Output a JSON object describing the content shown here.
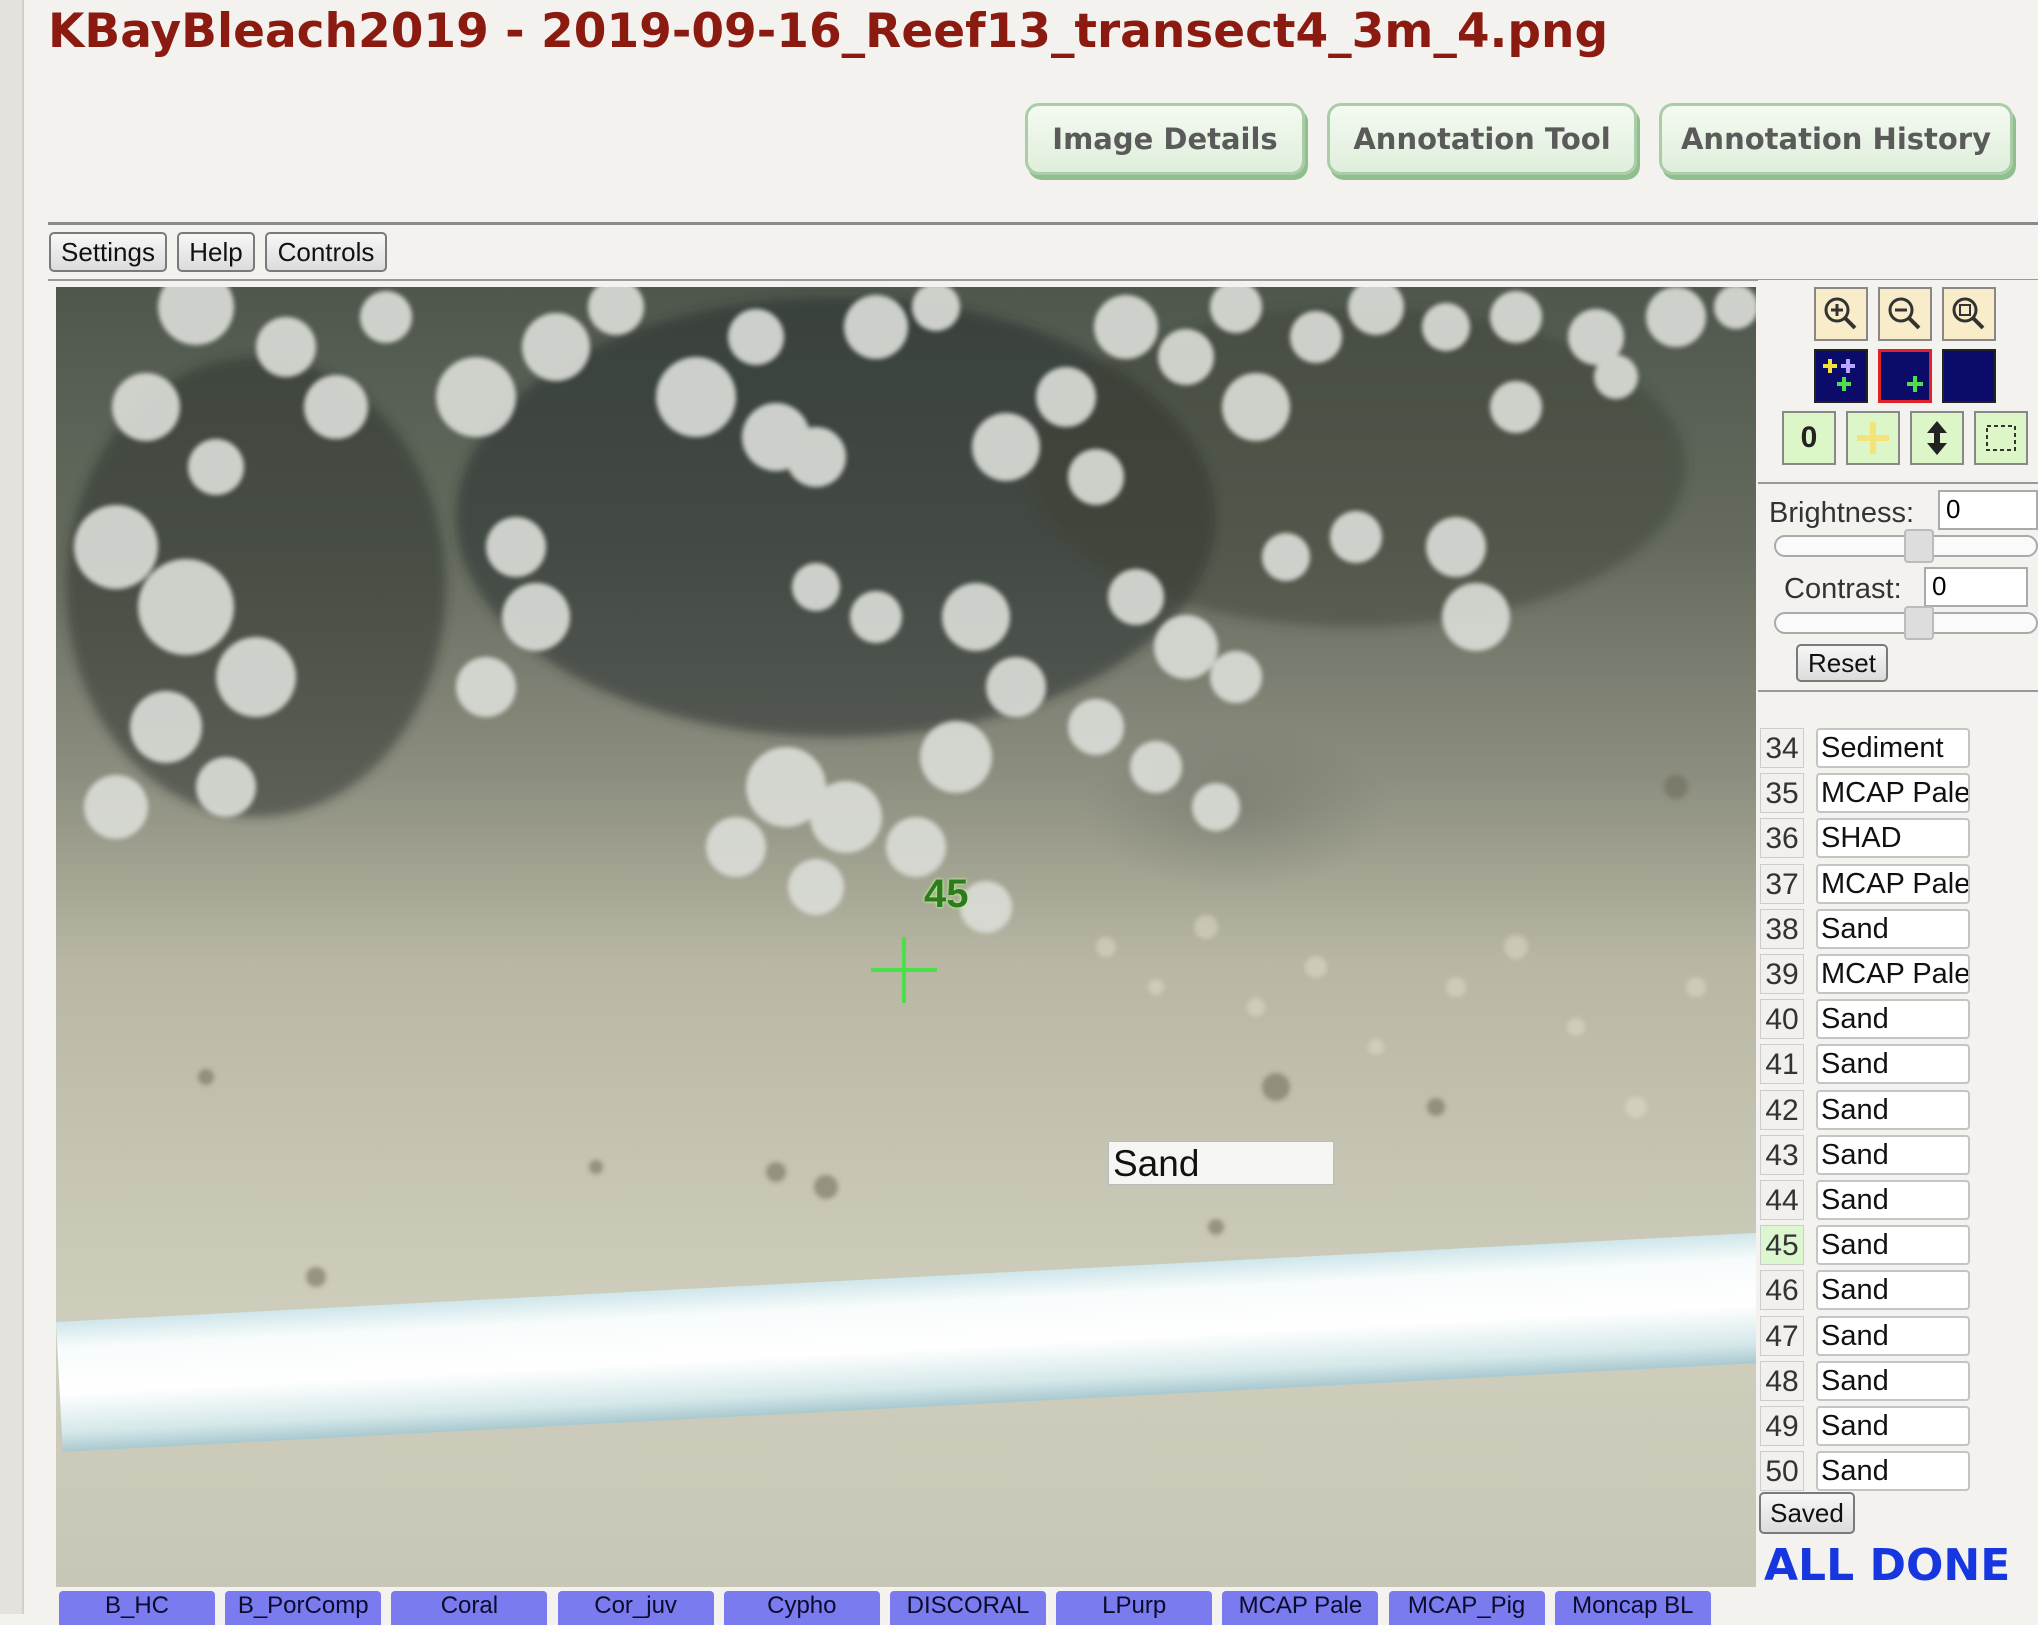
{
  "page": {
    "title": "KBayBleach2019 - 2019-09-16_Reef13_transect4_3m_4.png"
  },
  "nav": {
    "image_details": "Image Details",
    "annotation_tool": "Annotation Tool",
    "annotation_history": "Annotation History"
  },
  "toolbar": {
    "settings": "Settings",
    "help": "Help",
    "controls": "Controls"
  },
  "canvas": {
    "point_number": "45",
    "point_label_value": "Sand",
    "crosshair_color": "#4be04b"
  },
  "controls_panel": {
    "icons": [
      "zoom-in-icon",
      "zoom-out-icon",
      "zoom-fit-icon",
      "select-all-points-icon",
      "select-point-icon",
      "unselect-icon",
      "point-number-toggle-icon",
      "crosshair-toggle-icon",
      "move-icon",
      "rectangle-select-icon"
    ],
    "zero_button": "0",
    "brightness_label": "Brightness:",
    "brightness_value": "0",
    "contrast_label": "Contrast:",
    "contrast_value": "0",
    "reset": "Reset"
  },
  "points": [
    {
      "num": "34",
      "label": "Sediment"
    },
    {
      "num": "35",
      "label": "MCAP Pale"
    },
    {
      "num": "36",
      "label": "SHAD"
    },
    {
      "num": "37",
      "label": "MCAP Pale"
    },
    {
      "num": "38",
      "label": "Sand"
    },
    {
      "num": "39",
      "label": "MCAP Pale"
    },
    {
      "num": "40",
      "label": "Sand"
    },
    {
      "num": "41",
      "label": "Sand"
    },
    {
      "num": "42",
      "label": "Sand"
    },
    {
      "num": "43",
      "label": "Sand"
    },
    {
      "num": "44",
      "label": "Sand"
    },
    {
      "num": "45",
      "label": "Sand",
      "current": true
    },
    {
      "num": "46",
      "label": "Sand"
    },
    {
      "num": "47",
      "label": "Sand"
    },
    {
      "num": "48",
      "label": "Sand"
    },
    {
      "num": "49",
      "label": "Sand"
    },
    {
      "num": "50",
      "label": "Sand"
    }
  ],
  "status": {
    "saved": "Saved",
    "all_done": "ALL DONE"
  },
  "label_buttons": [
    "B_HC",
    "B_PorComp",
    "Coral",
    "Cor_juv",
    "Cypho",
    "DISCORAL",
    "LPurp",
    "MCAP Pale",
    "MCAP_Pig",
    "Moncap BL"
  ]
}
